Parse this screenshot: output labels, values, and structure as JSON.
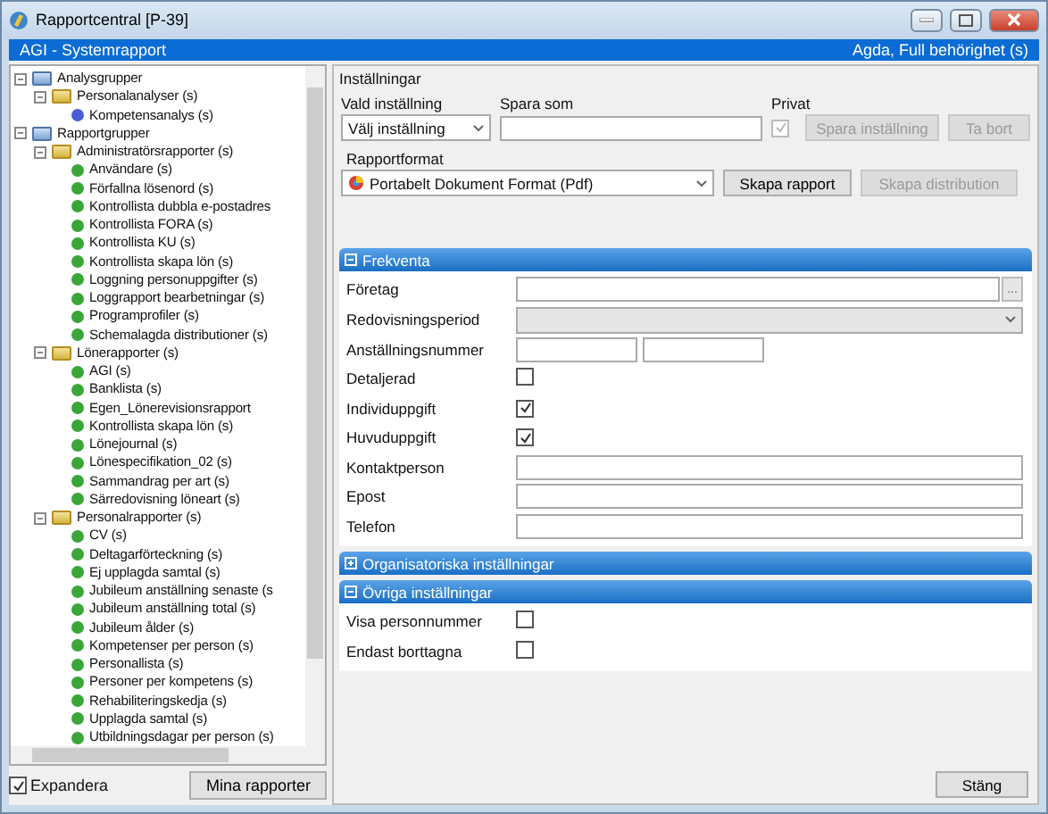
{
  "window": {
    "title": "Rapportcentral [P-39]"
  },
  "header": {
    "title": "AGI - Systemrapport",
    "user": "Agda, Full behörighet (s)"
  },
  "tree": [
    {
      "kind": "root",
      "label": "Analysgrupper",
      "expanded": true,
      "children": [
        {
          "kind": "folder",
          "label": "Personalanalyser (s)",
          "expanded": true,
          "children": [
            {
              "kind": "analysis",
              "label": "Kompetensanalys (s)"
            }
          ]
        }
      ]
    },
    {
      "kind": "root",
      "label": "Rapportgrupper",
      "expanded": true,
      "children": [
        {
          "kind": "folder",
          "label": "Administratörsrapporter (s)",
          "expanded": true,
          "children": [
            {
              "kind": "report",
              "label": "Användare (s)"
            },
            {
              "kind": "report",
              "label": "Förfallna lösenord (s)"
            },
            {
              "kind": "report",
              "label": "Kontrollista dubbla e-postadres"
            },
            {
              "kind": "report",
              "label": "Kontrollista FORA (s)"
            },
            {
              "kind": "report",
              "label": "Kontrollista KU (s)"
            },
            {
              "kind": "report",
              "label": "Kontrollista skapa lön (s)"
            },
            {
              "kind": "report",
              "label": "Loggning personuppgifter (s)"
            },
            {
              "kind": "report",
              "label": "Loggrapport bearbetningar (s)"
            },
            {
              "kind": "report",
              "label": "Programprofiler (s)"
            },
            {
              "kind": "report",
              "label": "Schemalagda distributioner (s)"
            }
          ]
        },
        {
          "kind": "folder",
          "label": "Lönerapporter (s)",
          "expanded": true,
          "children": [
            {
              "kind": "report",
              "label": "AGI (s)"
            },
            {
              "kind": "report",
              "label": "Banklista (s)"
            },
            {
              "kind": "report",
              "label": "Egen_Lönerevisionsrapport"
            },
            {
              "kind": "report",
              "label": "Kontrollista skapa lön (s)"
            },
            {
              "kind": "report",
              "label": "Lönejournal (s)"
            },
            {
              "kind": "report",
              "label": "Lönespecifikation_02 (s)"
            },
            {
              "kind": "report",
              "label": "Sammandrag per art (s)"
            },
            {
              "kind": "report",
              "label": "Särredovisning löneart (s)"
            }
          ]
        },
        {
          "kind": "folder",
          "label": "Personalrapporter (s)",
          "expanded": true,
          "children": [
            {
              "kind": "report",
              "label": "CV (s)"
            },
            {
              "kind": "report",
              "label": "Deltagarförteckning (s)"
            },
            {
              "kind": "report",
              "label": "Ej upplagda samtal (s)"
            },
            {
              "kind": "report",
              "label": "Jubileum anställning senaste (s"
            },
            {
              "kind": "report",
              "label": "Jubileum anställning total (s)"
            },
            {
              "kind": "report",
              "label": "Jubileum ålder (s)"
            },
            {
              "kind": "report",
              "label": "Kompetenser per person (s)"
            },
            {
              "kind": "report",
              "label": "Personallista (s)"
            },
            {
              "kind": "report",
              "label": "Personer per kompetens (s)"
            },
            {
              "kind": "report",
              "label": "Rehabiliteringskedja (s)"
            },
            {
              "kind": "report",
              "label": "Upplagda samtal (s)"
            },
            {
              "kind": "report",
              "label": "Utbildningsdagar per person (s)"
            }
          ]
        }
      ]
    }
  ],
  "expand_checkbox": {
    "label": "Expandera",
    "checked": true
  },
  "my_reports_button": "Mina rapporter",
  "settings": {
    "title": "Inställningar",
    "chosen_label": "Vald inställning",
    "chosen_value": "Välj inställning",
    "save_as_label": "Spara som",
    "private_label": "Privat",
    "private_checked": true,
    "private_disabled": true,
    "save_button": {
      "label": "Spara inställning",
      "disabled": true
    },
    "delete_button": {
      "label": "Ta bort",
      "disabled": true
    },
    "format_label": "Rapportformat",
    "format_value": "Portabelt Dokument Format (Pdf)",
    "create_button": {
      "label": "Skapa rapport",
      "disabled": false
    },
    "distribution_button": {
      "label": "Skapa distribution",
      "disabled": true
    }
  },
  "sections": [
    {
      "title": "Frekventa",
      "expanded": true,
      "rows": [
        {
          "kind": "lookup",
          "label": "Företag",
          "button": "..."
        },
        {
          "kind": "dropdown",
          "label": "Redovisningsperiod",
          "disabled": true
        },
        {
          "kind": "pair",
          "label": "Anställningsnummer"
        },
        {
          "kind": "checkbox",
          "label": "Detaljerad",
          "checked": false
        },
        {
          "kind": "checkbox",
          "label": "Individuppgift",
          "checked": true
        },
        {
          "kind": "checkbox",
          "label": "Huvuduppgift",
          "checked": true
        },
        {
          "kind": "text",
          "label": "Kontaktperson"
        },
        {
          "kind": "text",
          "label": "Epost"
        },
        {
          "kind": "text",
          "label": "Telefon"
        }
      ]
    },
    {
      "title": "Organisatoriska inställningar",
      "expanded": false
    },
    {
      "title": "Övriga inställningar",
      "expanded": true,
      "rows": [
        {
          "kind": "checkbox",
          "label": "Visa personnummer",
          "checked": false
        },
        {
          "kind": "checkbox",
          "label": "Endast borttagna",
          "checked": false
        }
      ]
    }
  ],
  "close_button": "Stäng"
}
